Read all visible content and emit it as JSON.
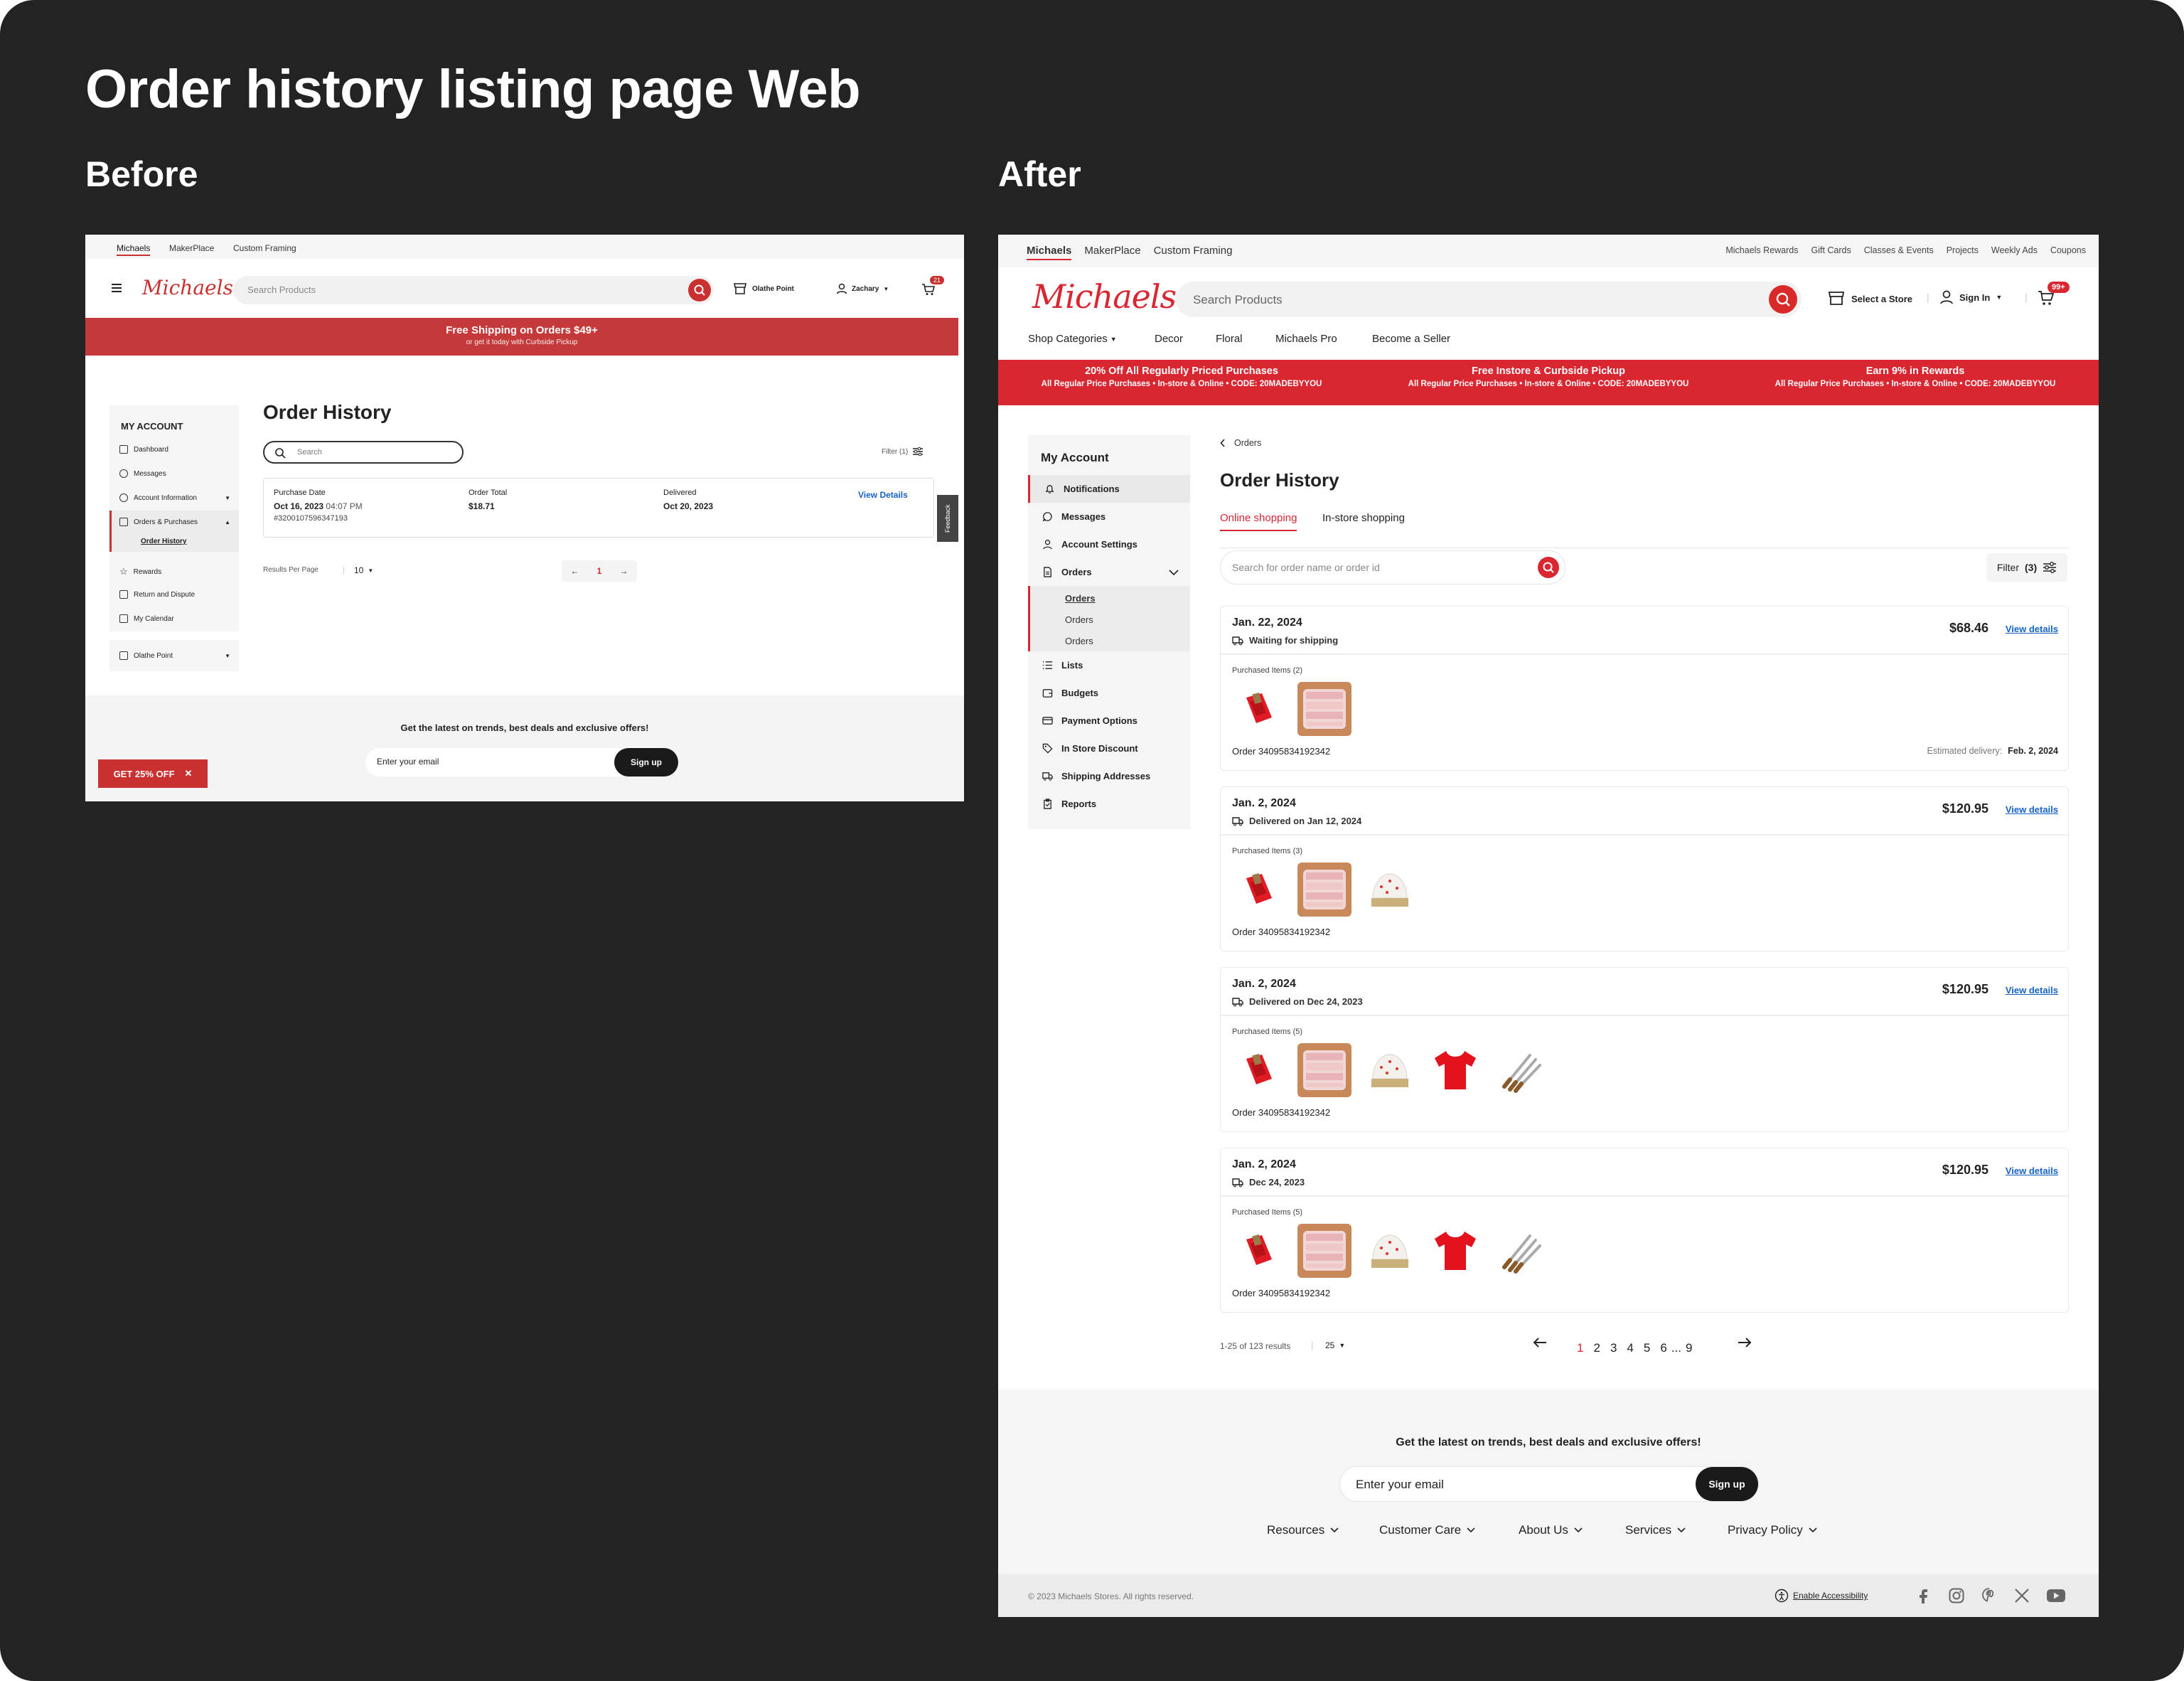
{
  "page_title": "Order history listing page Web",
  "before_label": "Before",
  "after_label": "After",
  "before": {
    "top_links": [
      "Michaels",
      "MakerPlace",
      "Custom Framing"
    ],
    "logo": "Michaels",
    "search_placeholder": "Search Products",
    "store": "Olathe Point",
    "user": "Zachary",
    "cart_count": "21",
    "promo_title": "Free Shipping on Orders $49+",
    "promo_sub": "or get it today with Curbside Pickup",
    "account_heading": "MY ACCOUNT",
    "sidebar": [
      "Dashboard",
      "Messages",
      "Account Information",
      "Orders & Purchases",
      "Order History",
      "Rewards",
      "Return and Dispute",
      "My Calendar"
    ],
    "sidebar_store": "Olathe Point",
    "heading": "Order History",
    "search": "Search",
    "filter": "Filter (1)",
    "order": {
      "purchase_date_label": "Purchase Date",
      "purchase_date": "Oct 16, 2023",
      "purchase_time": "04:07 PM",
      "order_number": "#320010759634719​3",
      "total_label": "Order Total",
      "total": "$18.71",
      "delivered_label": "Delivered",
      "delivered": "Oct 20, 2023",
      "view": "View Details"
    },
    "feedback": "Feedback",
    "results_per_page_label": "Results Per Page",
    "results_per_page": "10",
    "page": "1",
    "newsletter": "Get the latest on trends, best deals and exclusive offers!",
    "email_placeholder": "Enter your email",
    "signup": "Sign up",
    "discount_badge": "GET 25% OFF"
  },
  "after": {
    "top_links": [
      "Michaels",
      "MakerPlace",
      "Custom Framing"
    ],
    "top_right_links": [
      "Michaels Rewards",
      "Gift Cards",
      "Classes & Events",
      "Projects",
      "Weekly Ads",
      "Coupons"
    ],
    "logo": "Michaels",
    "search_placeholder": "Search Products",
    "select_store": "Select a Store",
    "sign_in": "Sign In",
    "cart_count": "99+",
    "nav": [
      "Shop Categories",
      "Decor",
      "Floral",
      "Michaels Pro",
      "Become a Seller"
    ],
    "promos": [
      {
        "title": "20% Off All Regularly Priced Purchases",
        "sub": "All Regular Price Purchases  •  In-store & Online  •  CODE: 20MADEBYYOU"
      },
      {
        "title": "Free Instore & Curbside Pickup",
        "sub": "All Regular Price Purchases  •  In-store & Online  •  CODE: 20MADEBYYOU"
      },
      {
        "title": "Earn 9% in Rewards",
        "sub": "All Regular Price Purchases  •  In-store & Online  •  CODE: 20MADEBYYOU"
      }
    ],
    "account_heading": "My Account",
    "sidebar": [
      "Notifications",
      "Messages",
      "Account Settings",
      "Orders",
      "Lists",
      "Budgets",
      "Payment Options",
      "In Store Discount",
      "Shipping Addresses",
      "Reports"
    ],
    "sidebar_sub": [
      "Orders",
      "Orders",
      "Orders"
    ],
    "breadcrumb": "Orders",
    "heading": "Order History",
    "tabs": [
      "Online shopping",
      "In-store shopping"
    ],
    "search_placeholder2": "Search for order name or order id",
    "filter_label": "Filter",
    "filter_count": "(3)",
    "purchased_label": "Purchased Items",
    "view_details": "View details",
    "orders": [
      {
        "date": "Jan. 22, 2024",
        "status": "Waiting for shipping",
        "price": "$68.46",
        "items_count": "(2)",
        "order_id": "Order 34095834192342",
        "estimated_label": "Estimated delivery:",
        "estimated": "Feb. 2, 2024"
      },
      {
        "date": "Jan. 2, 2024",
        "status": "Delivered on Jan 12, 2024",
        "price": "$120.95",
        "items_count": "(3)",
        "order_id": "Order 34095834192342"
      },
      {
        "date": "Jan. 2, 2024",
        "status": "Delivered on Dec 24, 2023",
        "price": "$120.95",
        "items_count": "(5)",
        "order_id": "Order 34095834192342"
      },
      {
        "date": "Jan. 2, 2024",
        "status": "Dec 24, 2023",
        "price": "$120.95",
        "items_count": "(5)",
        "order_id": "Order 34095834192342"
      }
    ],
    "results_text": "1-25 of 123 results",
    "per_page": "25",
    "pages": [
      "1",
      "2",
      "3",
      "4",
      "5",
      "6",
      "...",
      "9"
    ],
    "current_page": "1",
    "newsletter": "Get the latest on trends, best deals and exclusive offers!",
    "email_placeholder": "Enter your email",
    "signup": "Sign up",
    "footer_links": [
      "Resources",
      "Customer Care",
      "About Us",
      "Services",
      "Privacy Policy"
    ],
    "copyright": "© 2023 Michaels Stores. All rights reserved.",
    "accessibility": "Enable Accessibility"
  },
  "colors": {
    "brand_red": "#d92732",
    "link_blue": "#1763c4",
    "backdrop": "#232323"
  }
}
